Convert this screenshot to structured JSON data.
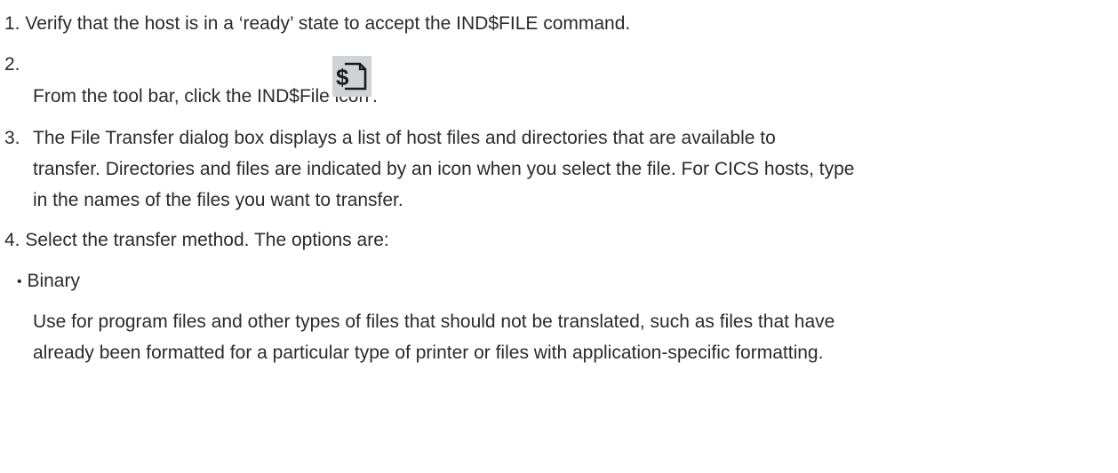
{
  "steps": [
    {
      "number": "1.",
      "text": "Verify that the host is in a ‘ready’ state to accept the IND$FILE command."
    },
    {
      "number": "2.",
      "text": "From the tool bar, click the IND$File icon",
      "trailing": ".",
      "icon": "ind-file-transfer-icon"
    },
    {
      "number": "3.",
      "lines": [
        "The File Transfer dialog box displays a list of host files and directories that are available to",
        "transfer. Directories and files are indicated by an icon when you select the file. For CICS hosts, type",
        "in the names of the files you want to transfer."
      ]
    },
    {
      "number": "4.",
      "text": "Select the transfer method. The options are:"
    }
  ],
  "options": [
    {
      "bullet": "•",
      "label": "Binary",
      "description_lines": [
        "Use for program files and other types of files that should not be translated, such as files that have",
        "already been formatted for a particular type of printer or files with application-specific formatting."
      ]
    }
  ]
}
